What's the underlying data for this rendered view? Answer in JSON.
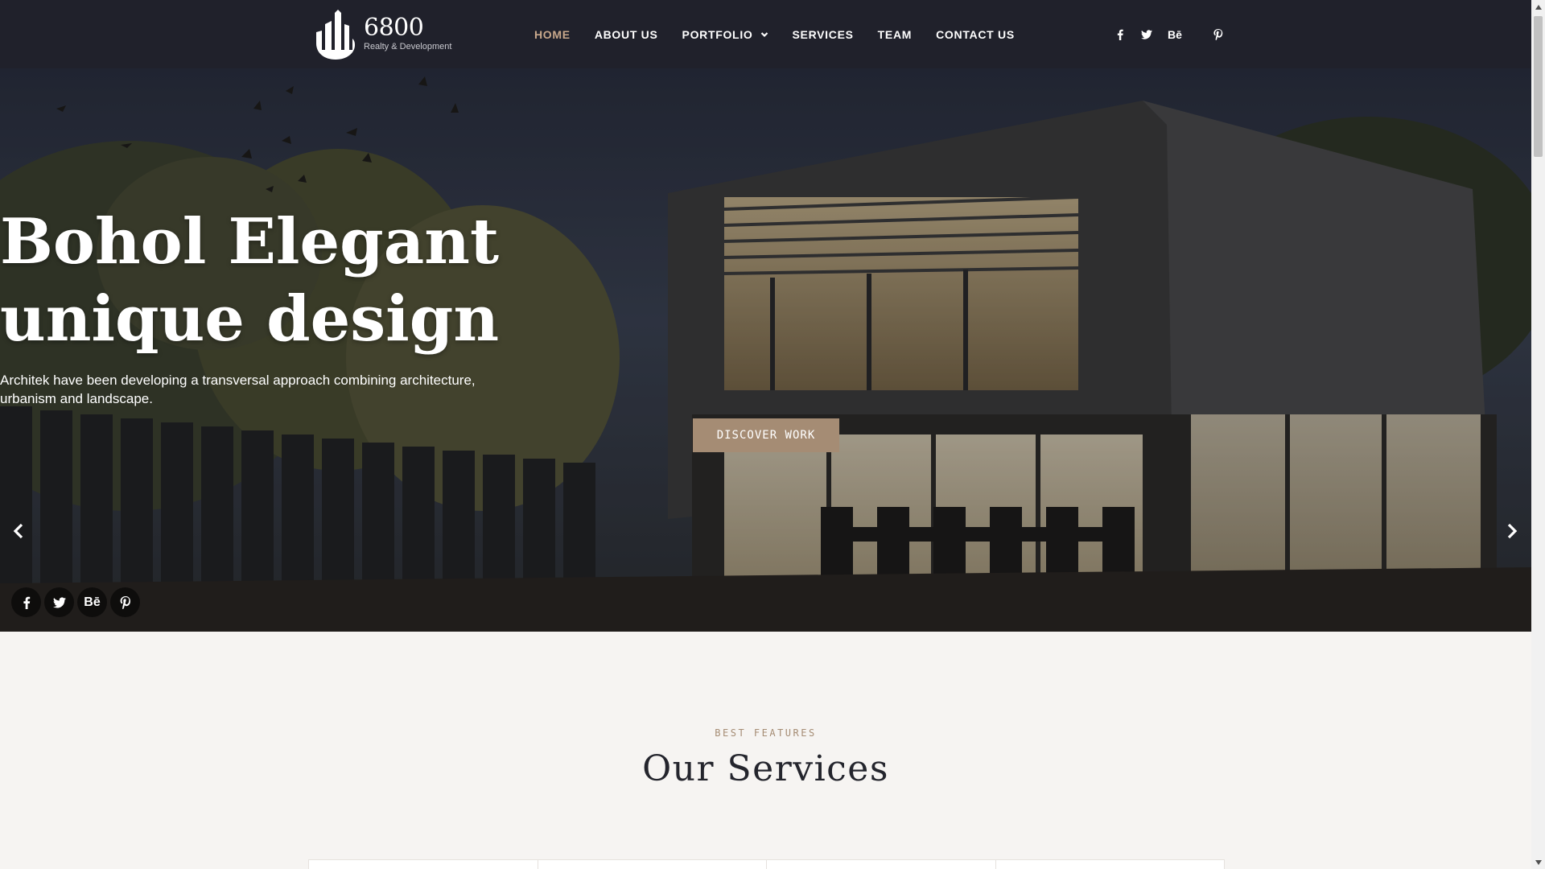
{
  "logo": {
    "title": "6800",
    "subtitle": "Realty & Development"
  },
  "nav": {
    "items": [
      {
        "label": "HOME",
        "active": true
      },
      {
        "label": "ABOUT US"
      },
      {
        "label": "PORTFOLIO",
        "has_dropdown": true
      },
      {
        "label": "SERVICES"
      },
      {
        "label": "TEAM"
      },
      {
        "label": "CONTACT US"
      }
    ]
  },
  "social": {
    "items": [
      {
        "icon": "facebook-icon"
      },
      {
        "icon": "twitter-icon"
      },
      {
        "icon": "behance-icon",
        "label": "Bē"
      },
      {
        "icon": "pinterest-icon"
      }
    ]
  },
  "hero": {
    "title_line1": "Bohol Elegant",
    "title_line2": "unique design",
    "desc_line1": "Architek have been developing a transversal approach combining architecture,",
    "desc_line2": "urbanism and landscape.",
    "button": "DISCOVER WORK"
  },
  "services": {
    "subtitle": "BEST FEATURES",
    "title": "Our Services"
  },
  "colors": {
    "header_bg": "#20212b",
    "accent": "#a58c74",
    "nav_active": "#c9a98c",
    "page_bg": "#f6f4f2"
  }
}
